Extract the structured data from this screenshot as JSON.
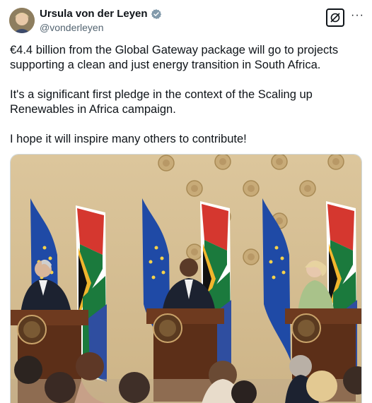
{
  "author": {
    "display_name": "Ursula von der Leyen",
    "handle": "@vonderleyen",
    "verified": true,
    "verified_icon": "verified-badge-icon"
  },
  "actions": {
    "grok_icon": "grok-icon",
    "more_icon": "more-options-icon",
    "more_label": "···"
  },
  "post": {
    "paragraphs": [
      "€4.4 billion from the Global Gateway package will go to projects supporting a clean and just energy transition in South Africa.",
      "It's a significant first pledge in the context of the Scaling up Renewables in Africa campaign.",
      "I hope it will inspire many others to contribute!"
    ]
  },
  "media": {
    "kind": "photo",
    "icon": "press-conference-photo"
  },
  "colors": {
    "text_primary": "#0f1419",
    "text_secondary": "#536471",
    "verified_badge": "#829aab",
    "wall": "#d8c296",
    "podium": "#6e3a1f"
  }
}
